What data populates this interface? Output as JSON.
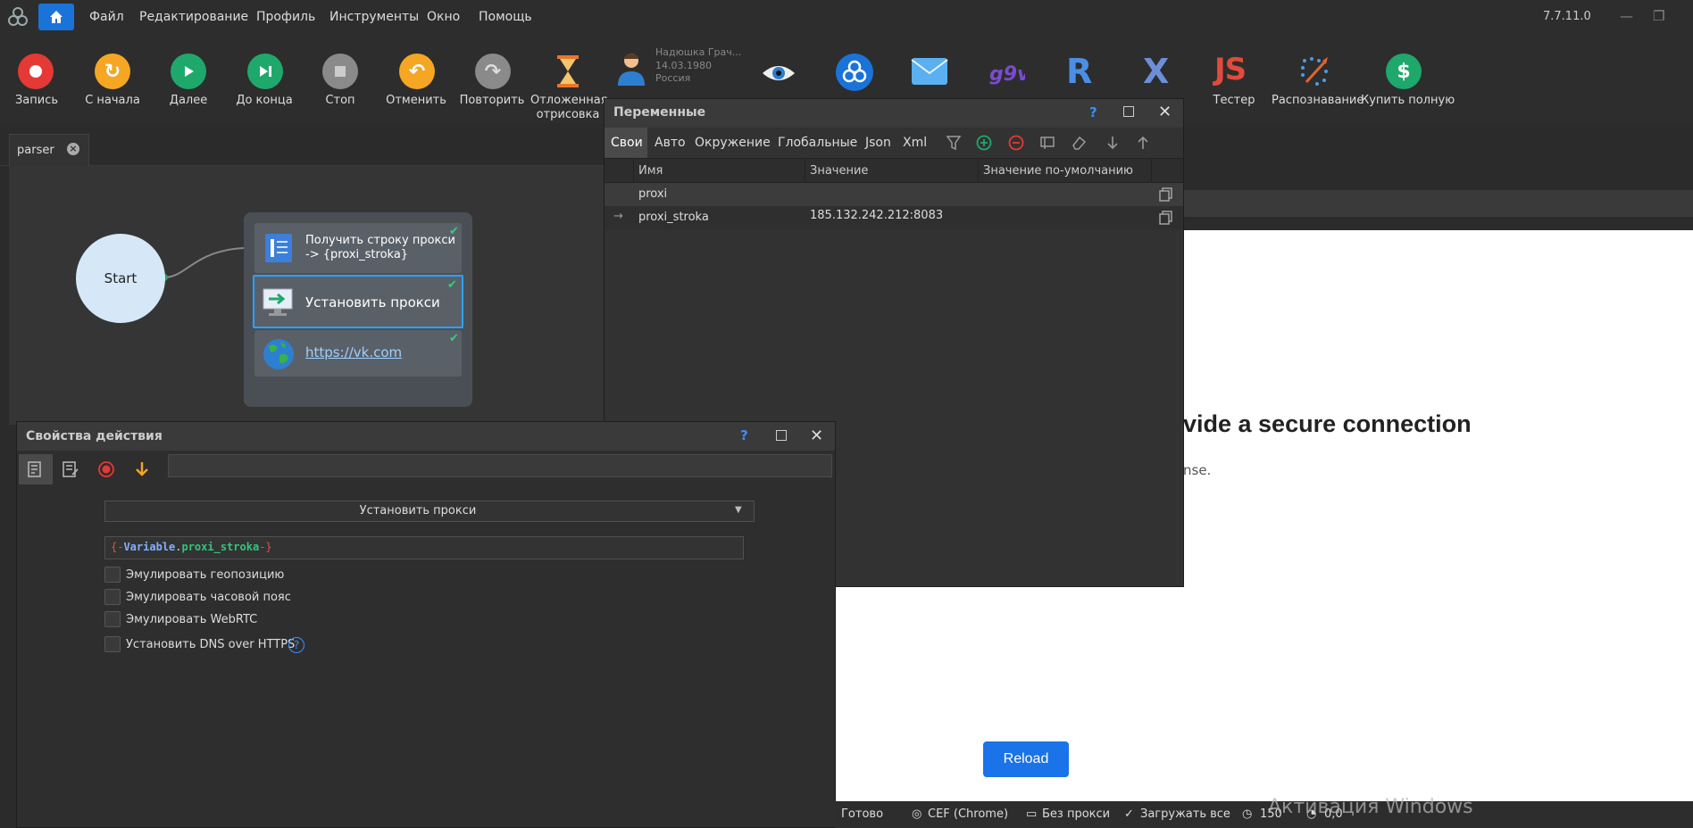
{
  "menubar": {
    "items": [
      "Файл",
      "Редактирование",
      "Профиль",
      "Инструменты",
      "Окно",
      "Помощь"
    ],
    "version": "7.7.11.0"
  },
  "toolbar": {
    "buttons": [
      {
        "label": "Запись",
        "color": "#e53935",
        "icon": "record-icon"
      },
      {
        "label": "С начала",
        "color": "#f5a623",
        "icon": "restart-icon"
      },
      {
        "label": "Далее",
        "color": "#1fa86b",
        "icon": "play-icon"
      },
      {
        "label": "До конца",
        "color": "#1fa86b",
        "icon": "play-to-end-icon"
      },
      {
        "label": "Стоп",
        "color": "#8a8a8a",
        "icon": "stop-icon"
      },
      {
        "label": "Отменить",
        "color": "#f5a623",
        "icon": "undo-icon"
      },
      {
        "label": "Повторить",
        "color": "#8a8a8a",
        "icon": "redo-icon"
      },
      {
        "label": "Отложенная",
        "label2": "отрисовка",
        "icon": "hourglass-icon"
      }
    ],
    "profile": {
      "name": "Надюшка Грач...",
      "date": "14.03.1980",
      "country": "Россия"
    },
    "right_buttons": [
      {
        "label": "Тестер",
        "icon": "js-tester-icon"
      },
      {
        "label": "Распознавание",
        "icon": "recognition-icon"
      },
      {
        "label": "Купить полную",
        "icon": "dollar-icon"
      }
    ],
    "accent_color": "#1a73d9"
  },
  "tabs": {
    "parser": "parser"
  },
  "canvas": {
    "start_label": "Start",
    "actions": [
      {
        "line1": "Получить строку прокси",
        "line2": "-> {proxi_stroka}"
      },
      {
        "line1": "Установить прокси"
      },
      {
        "link": "https://vk.com"
      }
    ]
  },
  "variables_panel": {
    "title": "Переменные",
    "help": "?",
    "tabs": [
      "Свои",
      "Авто",
      "Окружение",
      "Глобальные",
      "Json",
      "Xml"
    ],
    "columns": [
      "Имя",
      "Значение",
      "Значение по-умолчанию"
    ],
    "rows": [
      {
        "name": "proxi",
        "value": "",
        "default": ""
      },
      {
        "marker": "→",
        "name": "proxi_stroka",
        "value": "185.132.242.212:8083",
        "default": ""
      }
    ]
  },
  "browser": {
    "heading": "vide a secure connection",
    "subtext": "nse.",
    "reload": "Reload",
    "watermark": "Активация Windows"
  },
  "properties_panel": {
    "title": "Свойства действия",
    "help": "?",
    "action_select": "Установить прокси",
    "proxy_prefix": "{-",
    "proxy_var": "Variable",
    "proxy_dot": ".",
    "proxy_name": "proxi_stroka",
    "proxy_suffix": "-}",
    "options": [
      "Эмулировать геопозицию",
      "Эмулировать часовой пояс",
      "Эмулировать WebRTC",
      "Установить DNS over HTTPS"
    ]
  },
  "statusbar": {
    "ready": "Готово",
    "engine": "CEF (Chrome)",
    "proxy": "Без прокси",
    "load": "Загружать все",
    "timeout": "150",
    "counter": "0,0"
  }
}
